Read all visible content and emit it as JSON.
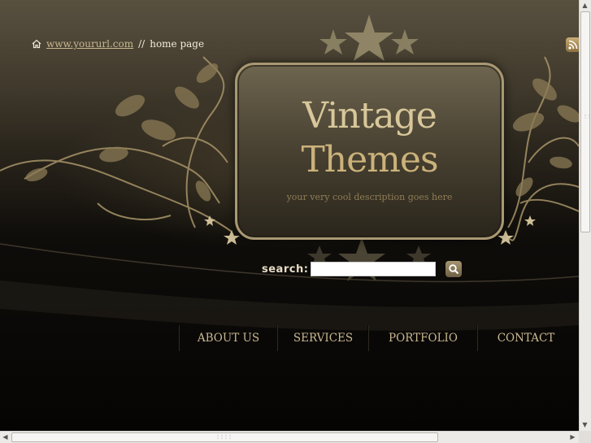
{
  "breadcrumb": {
    "link": "www.yoururl.com",
    "separator": "//",
    "current": "home page",
    "icon": "home-icon"
  },
  "header": {
    "title_line1": "Vintage",
    "title_line2": "Themes",
    "tagline": "your very cool description goes here"
  },
  "search": {
    "label": "search:",
    "value": "",
    "button_icon": "magnifier-icon"
  },
  "nav": [
    {
      "label": "ABOUT US"
    },
    {
      "label": "SERVICES"
    },
    {
      "label": "PORTFOLIO"
    },
    {
      "label": "CONTACT"
    }
  ],
  "rss": {
    "icon": "rss-icon"
  },
  "colors": {
    "gold": "#c9b890",
    "dark": "#0a0906",
    "frame_border": "#a89872"
  }
}
